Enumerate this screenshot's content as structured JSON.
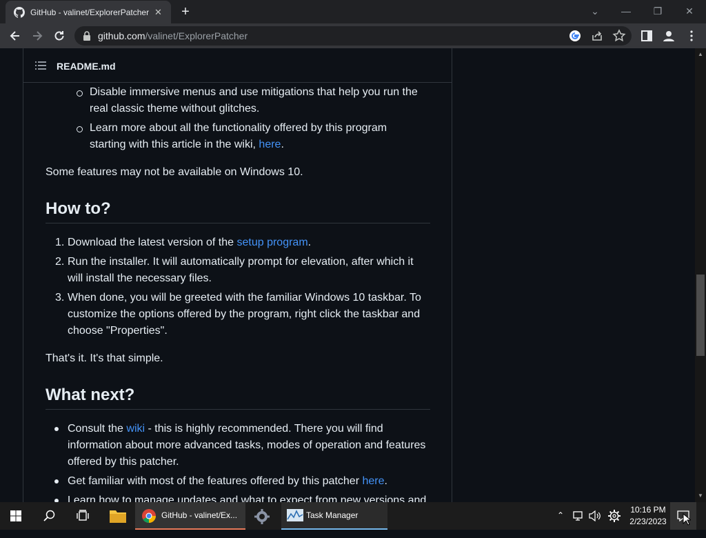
{
  "browser": {
    "tab_title": "GitHub - valinet/ExplorerPatcher",
    "url_host": "github.com",
    "url_path": "/valinet/ExplorerPatcher",
    "new_tab": "+",
    "minimize": "—",
    "restore": "❐",
    "close": "✕",
    "tab_search": "⌄"
  },
  "readme": {
    "title": "README.md",
    "sub_bullets": [
      {
        "line1": "Disable immersive menus and use mitigations that help you run the",
        "line2": "real classic theme without glitches."
      },
      {
        "line1": "Learn more about all the functionality offered by this program",
        "line2_pre": "starting with this article in the wiki, ",
        "line2_link": "here",
        "line2_post": "."
      }
    ],
    "note": "Some features may not be available on Windows 10.",
    "howto_heading": "How to?",
    "howto_steps": [
      {
        "num": "1.",
        "pre": "Download the latest version of the ",
        "link": "setup program",
        "post": "."
      },
      {
        "num": "2.",
        "line1": "Run the installer. It will automatically prompt for elevation, after which it",
        "line2": "will install the necessary files."
      },
      {
        "num": "3.",
        "line1": "When done, you will be greeted with the familiar Windows 10 taskbar. To",
        "line2": "customize the options offered by the program, right click the taskbar and",
        "line3": "choose \"Properties\"."
      }
    ],
    "simple": "That's it. It's that simple.",
    "next_heading": "What next?",
    "next_items": [
      {
        "pre": "Consult the ",
        "link": "wiki",
        "post": " - this is highly recommended. There you will find",
        "line2": "information about more advanced tasks, modes of operation and features",
        "line3": "offered by this patcher."
      },
      {
        "pre": "Get familiar with most of the features offered by this patcher ",
        "link": "here",
        "post": "."
      },
      {
        "pre": "Learn how to manage updates and what to expect from new versions and"
      }
    ]
  },
  "taskbar": {
    "chrome_label": "GitHub - valinet/Ex...",
    "taskmgr_label": "Task Manager",
    "time": "10:16 PM",
    "date": "2/23/2023"
  },
  "colors": {
    "accent_link": "#4493f8",
    "page_bg": "#0d1117",
    "chrome_underline": "#e87a5a"
  }
}
